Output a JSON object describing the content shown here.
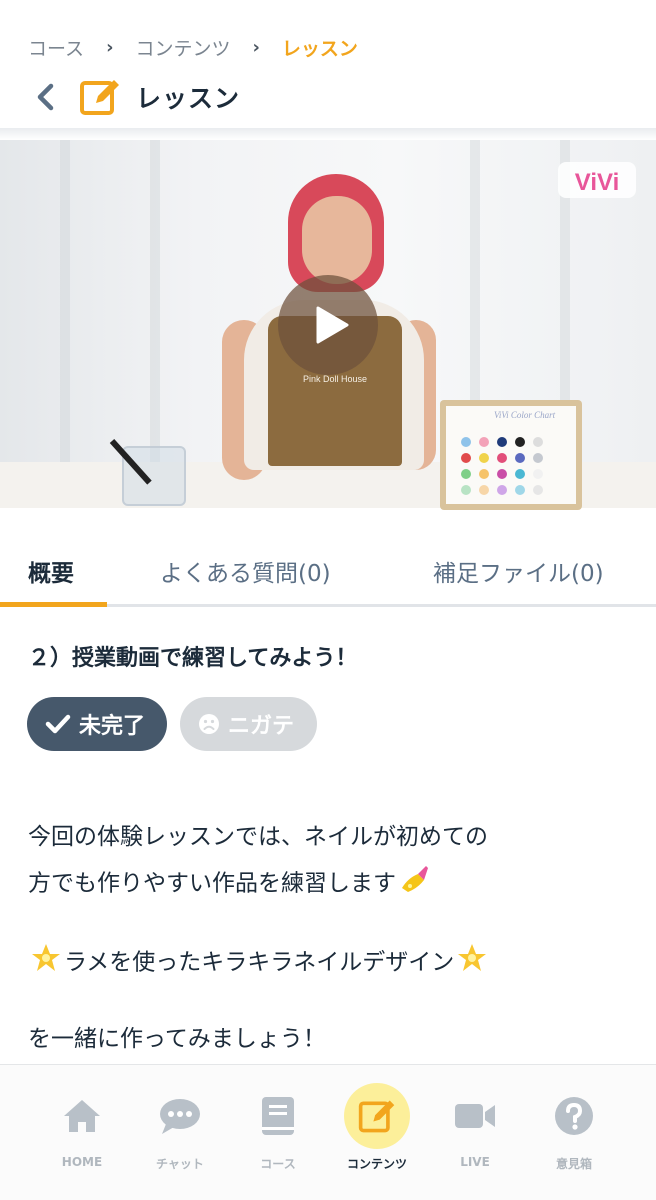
{
  "breadcrumb": {
    "items": [
      "コース",
      "コンテンツ",
      "レッスン"
    ]
  },
  "header": {
    "title": "レッスン"
  },
  "video": {
    "apron_text": "Pink Doll House",
    "board_text": "ViVi Color Chart",
    "logo_text": "ViVi"
  },
  "tabs": [
    {
      "label": "概要"
    },
    {
      "label": "よくある質問(0)"
    },
    {
      "label": "補足ファイル(0)"
    }
  ],
  "lesson": {
    "title": "２）授業動画で練習してみよう！",
    "status_chip": "未完了",
    "weak_chip": "ニガテ",
    "paragraph1_line1": "今回の体験レッスンでは、ネイルが初めての",
    "paragraph1_line2": "方でも作りやすい作品を練習します",
    "highlight": "ラメを使ったキラキラネイルデザイン",
    "paragraph2": "を一緒に作ってみましょう！"
  },
  "bottom_nav": [
    {
      "label": "HOME",
      "icon": "home-icon"
    },
    {
      "label": "チャット",
      "icon": "chat-icon"
    },
    {
      "label": "コース",
      "icon": "book-icon"
    },
    {
      "label": "コンテンツ",
      "icon": "edit-icon"
    },
    {
      "label": "LIVE",
      "icon": "video-camera-icon"
    },
    {
      "label": "意見箱",
      "icon": "question-icon"
    }
  ],
  "colors": {
    "accent": "#f2a51d",
    "dark": "#1c2b3a",
    "muted": "#5b6f85",
    "chip_dark": "#46586b",
    "chip_light": "#d6d9dc",
    "nav_active_bg": "#fcef9a"
  }
}
